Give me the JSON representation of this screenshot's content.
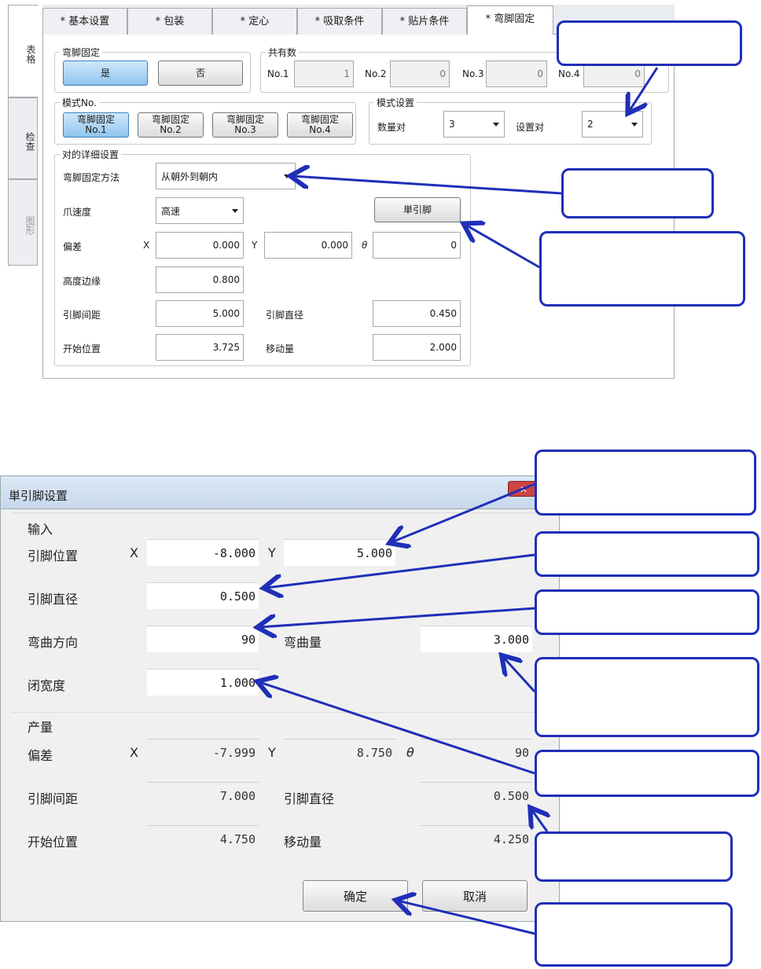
{
  "top": {
    "side_tabs": [
      "表格",
      "检查",
      "图形"
    ],
    "tabs": [
      "* 基本设置",
      "* 包装",
      "* 定心",
      "* 吸取条件",
      "* 贴片条件",
      "* 弯脚固定"
    ],
    "bend_fix": {
      "title": "弯脚固定",
      "yes": "是",
      "no": "否"
    },
    "shared": {
      "title": "共有数",
      "items": [
        {
          "label": "No.1",
          "value": "1"
        },
        {
          "label": "No.2",
          "value": "0"
        },
        {
          "label": "No.3",
          "value": "0"
        },
        {
          "label": "No.4",
          "value": "0"
        }
      ]
    },
    "pattern_no": {
      "title": "模式No.",
      "buttons": [
        {
          "line1": "弯脚固定",
          "line2": "No.1"
        },
        {
          "line1": "弯脚固定",
          "line2": "No.2"
        },
        {
          "line1": "弯脚固定",
          "line2": "No.3"
        },
        {
          "line1": "弯脚固定",
          "line2": "No.4"
        }
      ]
    },
    "pattern_set": {
      "title": "模式设置",
      "count_label": "数量对",
      "count_value": "3",
      "set_label": "设置对",
      "set_value": "2"
    },
    "detail": {
      "title": "对的详细设置",
      "method_label": "弯脚固定方法",
      "method_value": "从朝外到朝内",
      "speed_label": "爪速度",
      "speed_value": "高速",
      "single_button": "単引脚",
      "offset_label": "偏差",
      "x_label": "X",
      "x_value": "0.000",
      "y_label": "Y",
      "y_value": "0.000",
      "theta_label": "θ",
      "theta_value": "0",
      "height_label": "高度边缘",
      "height_value": "0.800",
      "pitch_label": "引脚间距",
      "pitch_value": "5.000",
      "diameter_label": "引脚直径",
      "diameter_value": "0.450",
      "start_label": "开始位置",
      "start_value": "3.725",
      "move_label": "移动量",
      "move_value": "2.000"
    }
  },
  "dialog": {
    "title": "単引脚设置",
    "close": "✕",
    "input_section": "输入",
    "pos_label": "引脚位置",
    "pos_x_label": "X",
    "pos_x": "-8.000",
    "pos_y_label": "Y",
    "pos_y": "5.000",
    "dia_label": "引脚直径",
    "dia": "0.500",
    "dir_label": "弯曲方向",
    "dir": "90",
    "bend_label": "弯曲量",
    "bend": "3.000",
    "close_label": "闭宽度",
    "close_width": "1.000",
    "output_section": "产量",
    "off_label": "偏差",
    "off_x_label": "X",
    "off_x": "-7.999",
    "off_y_label": "Y",
    "off_y": "8.750",
    "off_t_label": "θ",
    "off_t": "90",
    "pitch_label": "引脚间距",
    "pitch": "7.000",
    "odia_label": "引脚直径",
    "odia": "0.500",
    "start_label": "开始位置",
    "start": "4.750",
    "move_label": "移动量",
    "move": "4.250",
    "ok": "确定",
    "cancel": "取消"
  },
  "colors": {
    "callout_border": "#1f2fb8",
    "selected_button": "#8fc4ee"
  }
}
